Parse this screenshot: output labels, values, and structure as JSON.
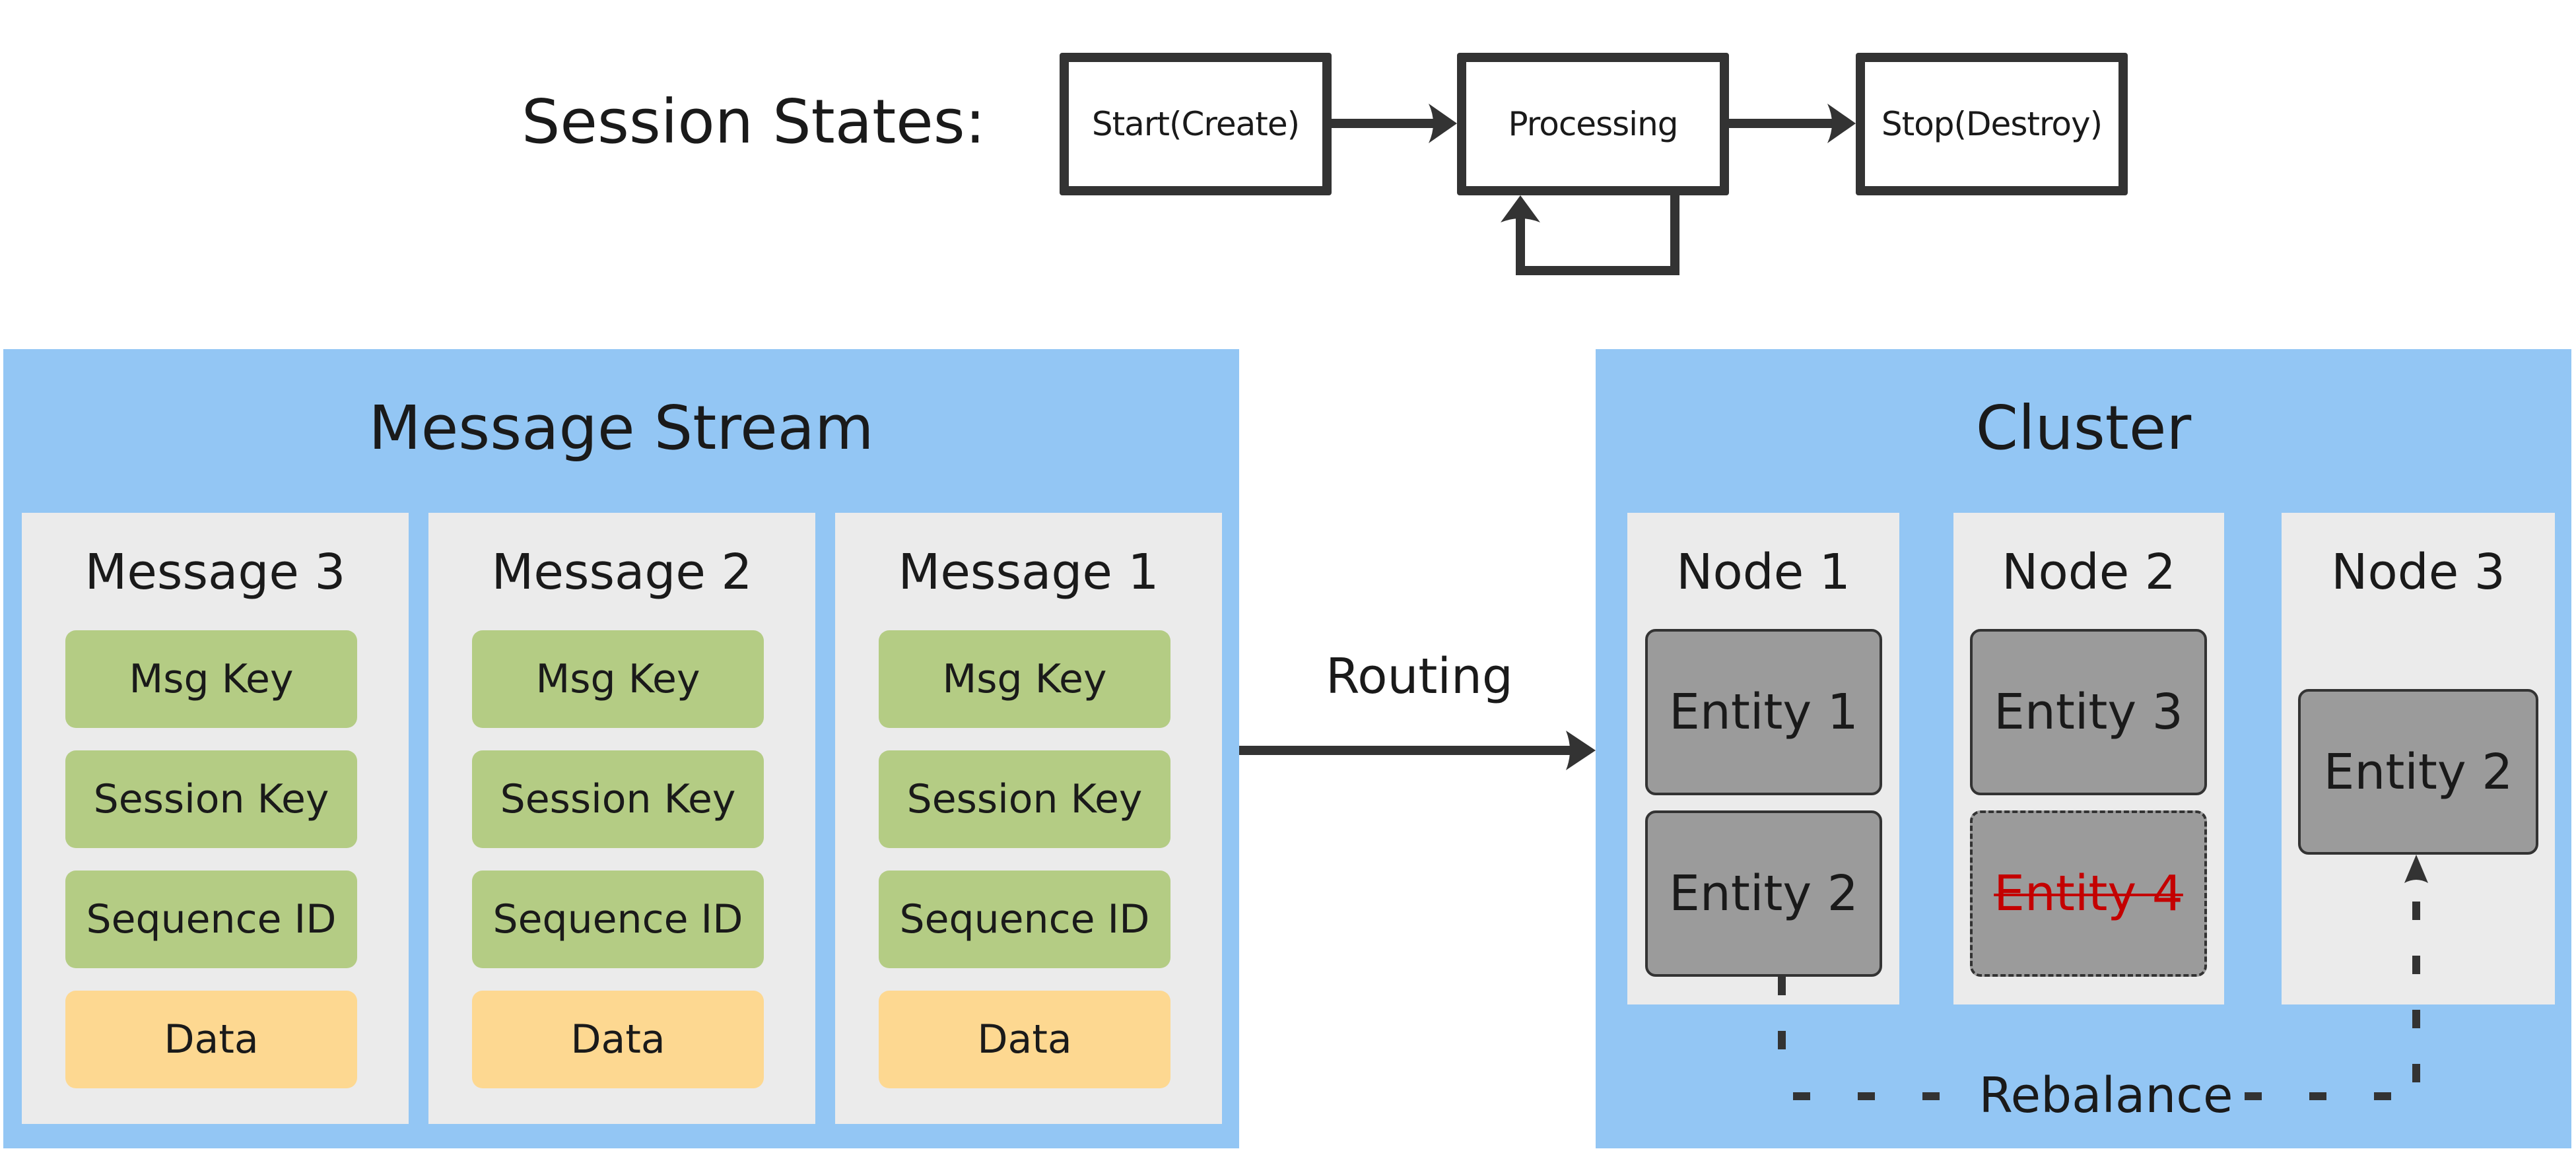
{
  "session_states": {
    "label": "Session States:",
    "states": [
      {
        "id": "start",
        "label": "Start(Create)"
      },
      {
        "id": "processing",
        "label": "Processing"
      },
      {
        "id": "stop",
        "label": "Stop(Destroy)"
      }
    ],
    "transitions": [
      {
        "from": "start",
        "to": "processing"
      },
      {
        "from": "processing",
        "to": "processing"
      },
      {
        "from": "processing",
        "to": "stop"
      }
    ]
  },
  "message_stream": {
    "title": "Message Stream",
    "messages": [
      {
        "title": "Message 3",
        "fields": [
          "Msg Key",
          "Session Key",
          "Sequence ID",
          "Data"
        ]
      },
      {
        "title": "Message 2",
        "fields": [
          "Msg Key",
          "Session Key",
          "Sequence ID",
          "Data"
        ]
      },
      {
        "title": "Message 1",
        "fields": [
          "Msg Key",
          "Session Key",
          "Sequence ID",
          "Data"
        ]
      }
    ]
  },
  "routing": {
    "label": "Routing"
  },
  "cluster": {
    "title": "Cluster",
    "nodes": [
      {
        "title": "Node 1",
        "entities": [
          {
            "label": "Entity 1",
            "removed": false
          },
          {
            "label": "Entity 2",
            "removed": false
          }
        ]
      },
      {
        "title": "Node 2",
        "entities": [
          {
            "label": "Entity 3",
            "removed": false
          },
          {
            "label": "Entity 4",
            "removed": true
          }
        ]
      },
      {
        "title": "Node 3",
        "entities": [
          {
            "label": "Entity 2",
            "removed": false
          }
        ]
      }
    ],
    "rebalance": {
      "label": "Rebalance",
      "from": "Node 1 / Entity 2",
      "to": "Node 3 / Entity 2"
    }
  },
  "colors": {
    "panel_bg": "#93c6f4",
    "card_bg": "#ebebeb",
    "key_field": "#b4cc84",
    "data_field": "#fdd891",
    "entity_fill": "#9b9b9b",
    "removed_text": "#c40000",
    "stroke": "#333333"
  }
}
